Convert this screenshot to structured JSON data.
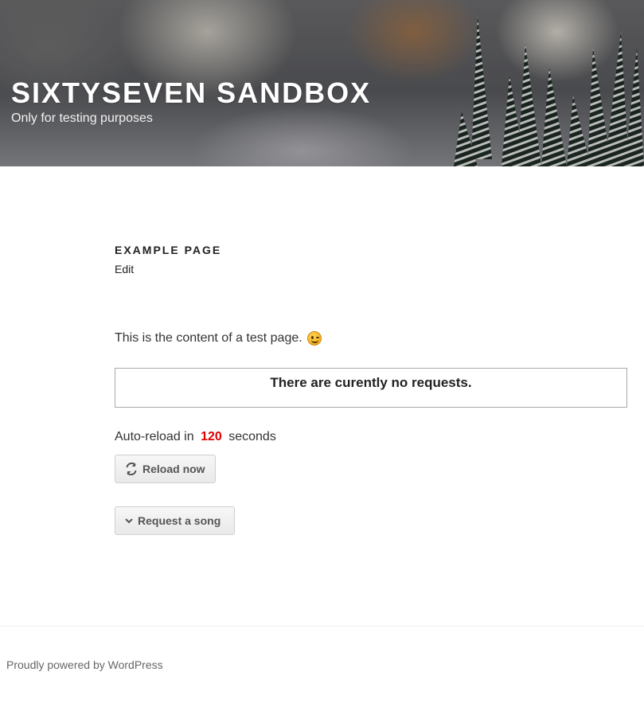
{
  "header": {
    "site_title": "SIXTYSEVEN SANDBOX",
    "site_description": "Only for testing purposes"
  },
  "page": {
    "title": "EXAMPLE PAGE",
    "edit_label": "Edit",
    "content": "This is the content of a test page.",
    "content_emoji": "winking-face"
  },
  "requests": {
    "empty_message": "There are curently no requests."
  },
  "autoreload": {
    "prefix": "Auto-reload in",
    "seconds": "120",
    "suffix": "seconds",
    "count_color": "#e00000"
  },
  "buttons": {
    "reload_label": "Reload now",
    "reload_icon": "refresh-icon",
    "request_label": "Request a song",
    "request_icon": "chevron-down-icon"
  },
  "footer": {
    "powered_by": "Proudly powered by WordPress"
  }
}
